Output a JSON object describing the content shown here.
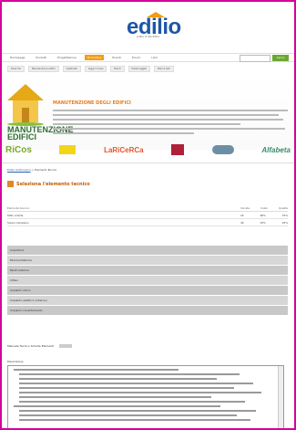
{
  "brand": {
    "name": "edilio",
    "tagline": "edilio.it dal 2001",
    "accent": "#1f56a6",
    "frame_color": "#d5009c"
  },
  "topnav": {
    "items": [
      "Homepage",
      "Prodotti",
      "Progettazione",
      "Normativa",
      "Eventi",
      "Forum",
      "Libri"
    ],
    "active_index": 3,
    "search_button": "Cerca"
  },
  "subnav": {
    "items": [
      "Ricerche",
      "Manutenzione edifici",
      "Capitolati",
      "Leggi in linea",
      "Bandi",
      "Prezzi leggeri",
      "Banca dati"
    ]
  },
  "banner": {
    "title_line1": "MANUTENZIONE",
    "title_line2": "EDIFICI",
    "heading": "MANUTENZIONE DEGLI EDIFICI",
    "house_icon": "house-icon"
  },
  "sponsors": {
    "left_logo": "RiCos",
    "middle_logo": "LaRiCeRCa",
    "right_logo": "Alfabeta"
  },
  "content": {
    "breadcrumb_link": "Edilio-Sottosopra",
    "breadcrumb_sep": " > ",
    "breadcrumb_current": "Elementi Tecnici",
    "section_title": "Seleziona l'elemento tecnico",
    "table_headers_left": "Elemento tecnico",
    "table_headers_right": [
      "Durata",
      "Costo",
      "Qualita"
    ],
    "rows": [
      {
        "label": "Tetto a falde",
        "values": [
          "25",
          "60%",
          "70%"
        ]
      },
      {
        "label": "Solaio interpiano",
        "values": [
          "40",
          "25%",
          "45%"
        ]
      }
    ],
    "grey_rows": [
      "Copertura",
      "Pavimentazione",
      "Pareti esterne",
      "Infissi",
      "Impianto idrico",
      "Impianto elettrico (interno)",
      "Impianto riscaldamento"
    ],
    "link_text": "Manuale Tecnico Schede Elementi",
    "edit_label": "Descrizione"
  }
}
